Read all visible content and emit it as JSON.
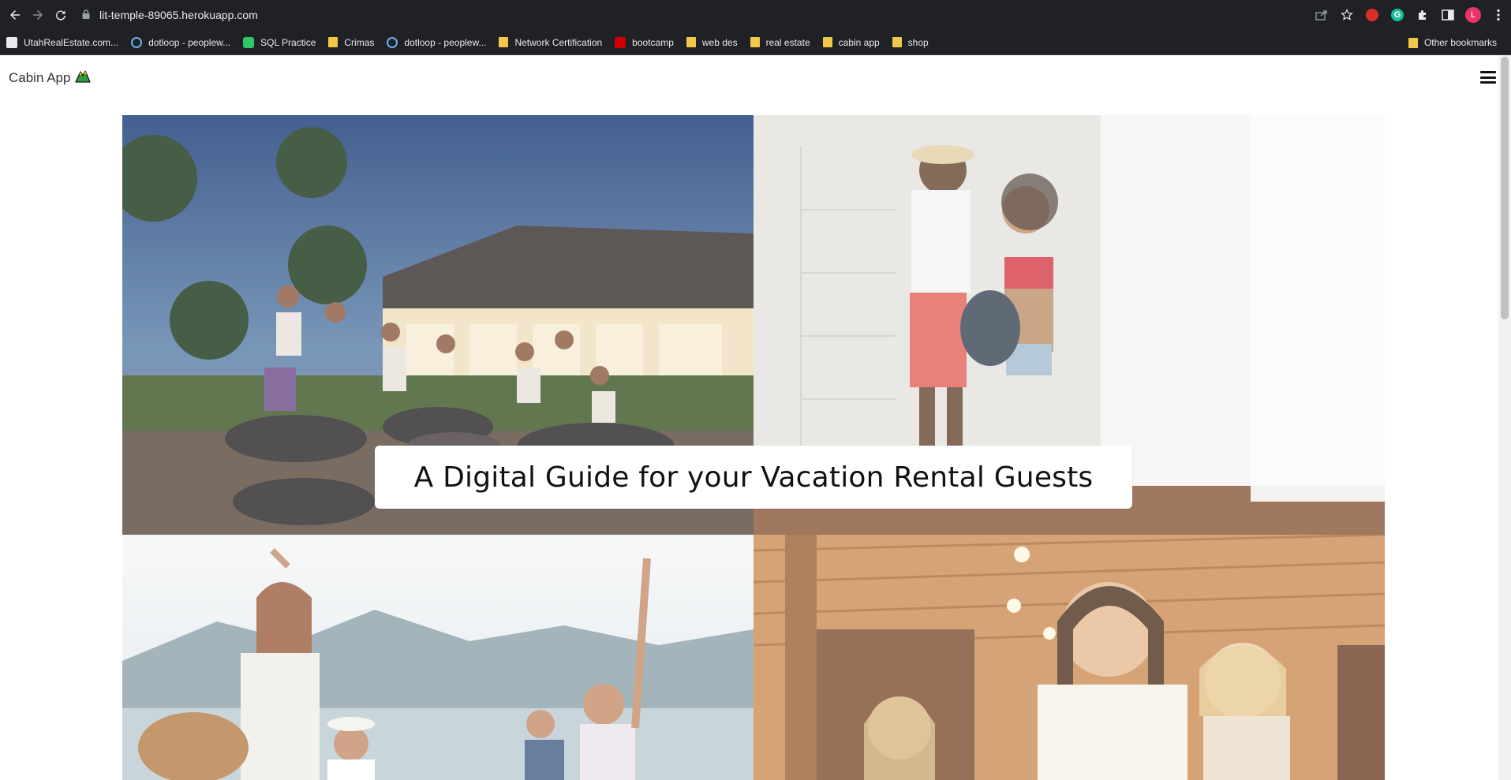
{
  "browser": {
    "url": "lit-temple-89065.herokuapp.com",
    "profile_initial": "L",
    "extension_g_label": "G"
  },
  "bookmarks": [
    {
      "label": "UtahRealEstate.com...",
      "icon": "site-icon"
    },
    {
      "label": "dotloop - peoplew...",
      "icon": "dotloop-icon"
    },
    {
      "label": "SQL Practice",
      "icon": "hackerrank-icon"
    },
    {
      "label": "Crimas",
      "icon": "folder-icon"
    },
    {
      "label": "dotloop - peoplew...",
      "icon": "dotloop-icon"
    },
    {
      "label": "Network Certification",
      "icon": "folder-icon"
    },
    {
      "label": "bootcamp",
      "icon": "utah-u-icon"
    },
    {
      "label": "web des",
      "icon": "folder-icon"
    },
    {
      "label": "real estate",
      "icon": "folder-icon"
    },
    {
      "label": "cabin app",
      "icon": "folder-icon"
    },
    {
      "label": "shop",
      "icon": "folder-icon"
    }
  ],
  "other_bookmarks": "Other bookmarks",
  "app": {
    "brand": "Cabin App",
    "brand_icon": "mountain-icon",
    "menu_icon": "hamburger-icon"
  },
  "hero": {
    "headline": "A Digital Guide for your Vacation Rental Guests"
  },
  "colors": {
    "chrome_bg": "#202124",
    "chrome_text": "#e8eaed",
    "page_bg": "#ffffff",
    "folder": "#f3c84a",
    "avatar": "#e8336b"
  }
}
